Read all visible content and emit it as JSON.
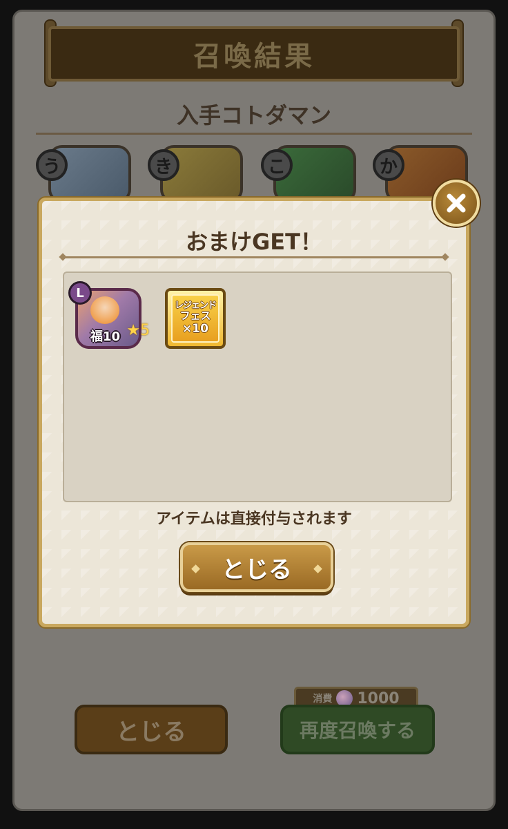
{
  "background_screen": {
    "title": "召喚結果",
    "subtitle": "入手コトダマン",
    "characters": [
      {
        "badge": "う",
        "color": "#4c6a88"
      },
      {
        "badge": "き",
        "color": "#8a7a3a"
      },
      {
        "badge": "こ",
        "color": "#3a6a3a"
      },
      {
        "badge": "か",
        "color": "#8a4a2a"
      }
    ],
    "close_label": "とじる",
    "resummon_label": "再度召喚する",
    "cost": {
      "label": "消費",
      "value": "1000",
      "icon": "gem-icon"
    }
  },
  "modal": {
    "title": "おまけGET！",
    "items": [
      {
        "type": "character",
        "rarity_badge": "L",
        "label": "福10",
        "star": "★5"
      },
      {
        "type": "ticket",
        "line1": "レジェンド",
        "line2": "フェス",
        "count": "×10"
      }
    ],
    "note": "アイテムは直接付与されます",
    "close_label": "とじる",
    "close_icon": "✕"
  }
}
